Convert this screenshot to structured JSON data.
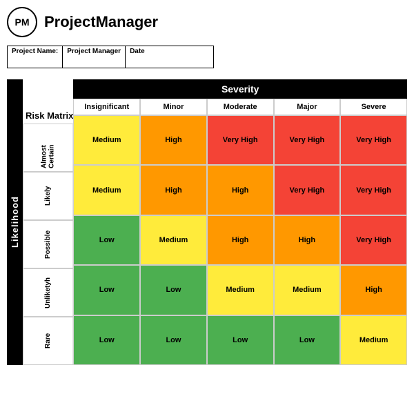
{
  "header": {
    "logo_text": "PM",
    "title": "ProjectManager"
  },
  "project_info": {
    "fields": [
      {
        "label": "Project Name:",
        "value": ""
      },
      {
        "label": "Project Manager",
        "value": ""
      },
      {
        "label": "Date",
        "value": ""
      }
    ]
  },
  "matrix": {
    "risk_matrix_label": "Risk Matrix",
    "severity_title": "Severity",
    "likelihood_label": "Likelihood",
    "col_headers": [
      "Insignificant",
      "Minor",
      "Moderate",
      "Major",
      "Severe"
    ],
    "rows": [
      {
        "label": "Almost Certain",
        "cells": [
          {
            "text": "Medium",
            "color": "c-yellow"
          },
          {
            "text": "High",
            "color": "c-orange"
          },
          {
            "text": "Very High",
            "color": "c-red"
          },
          {
            "text": "Very High",
            "color": "c-red"
          },
          {
            "text": "Very High",
            "color": "c-red"
          }
        ]
      },
      {
        "label": "Likely",
        "cells": [
          {
            "text": "Medium",
            "color": "c-yellow"
          },
          {
            "text": "High",
            "color": "c-orange"
          },
          {
            "text": "High",
            "color": "c-orange"
          },
          {
            "text": "Very High",
            "color": "c-red"
          },
          {
            "text": "Very High",
            "color": "c-red"
          }
        ]
      },
      {
        "label": "Possible",
        "cells": [
          {
            "text": "Low",
            "color": "c-green"
          },
          {
            "text": "Medium",
            "color": "c-yellow"
          },
          {
            "text": "High",
            "color": "c-orange"
          },
          {
            "text": "High",
            "color": "c-orange"
          },
          {
            "text": "Very High",
            "color": "c-red"
          }
        ]
      },
      {
        "label": "Unliketyh",
        "cells": [
          {
            "text": "Low",
            "color": "c-green"
          },
          {
            "text": "Low",
            "color": "c-green"
          },
          {
            "text": "Medium",
            "color": "c-yellow"
          },
          {
            "text": "Medium",
            "color": "c-yellow"
          },
          {
            "text": "High",
            "color": "c-orange"
          }
        ]
      },
      {
        "label": "Rare",
        "cells": [
          {
            "text": "Low",
            "color": "c-green"
          },
          {
            "text": "Low",
            "color": "c-green"
          },
          {
            "text": "Low",
            "color": "c-green"
          },
          {
            "text": "Low",
            "color": "c-green"
          },
          {
            "text": "Medium",
            "color": "c-yellow"
          }
        ]
      }
    ]
  }
}
